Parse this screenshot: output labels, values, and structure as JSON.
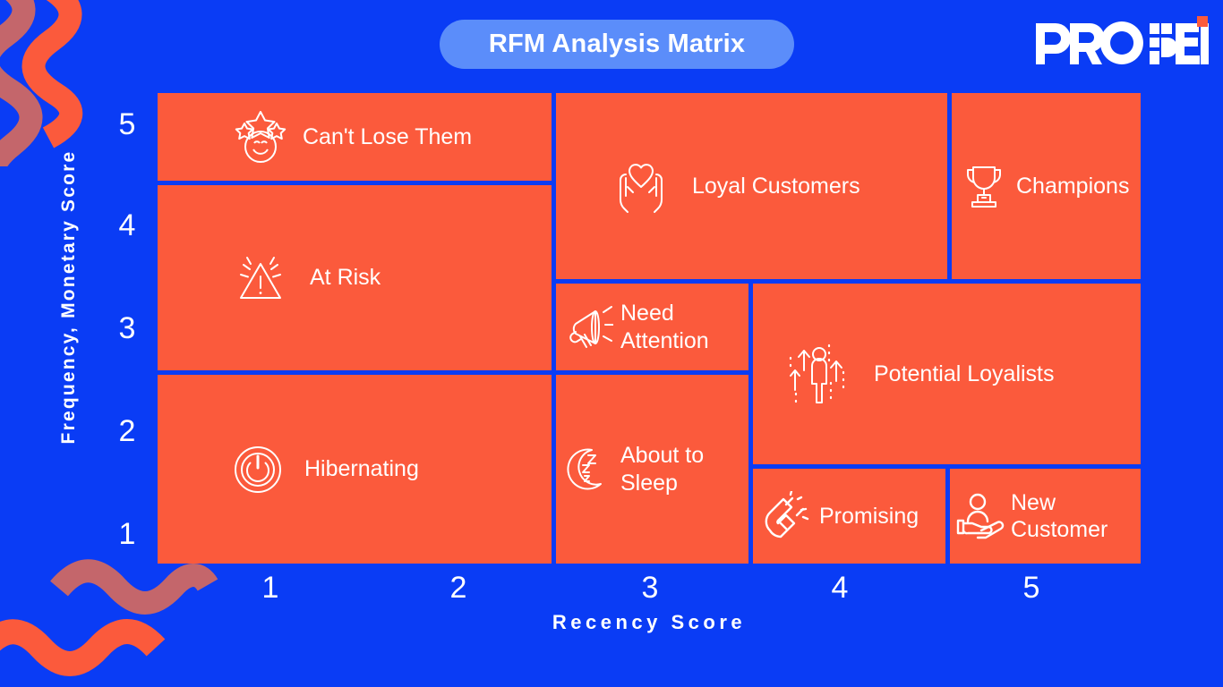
{
  "header": {
    "title": "RFM Analysis Matrix",
    "logo_text": "PROPEL",
    "logo_dot": "orange-square-dot"
  },
  "colors": {
    "background_blue": "#0a3cf5",
    "cell_orange": "#fb5a3c",
    "title_pill_blue": "#5b8dfa",
    "text_white": "#ffffff",
    "squiggle_rose": "#c4666b",
    "squiggle_orange": "#fb5a3c",
    "logo_dot_orange": "#fb5a3c"
  },
  "axes": {
    "y_title": "Frequency, Monetary Score",
    "x_title": "Recency Score",
    "y_ticks": [
      "5",
      "4",
      "3",
      "2",
      "1"
    ],
    "x_ticks": [
      "1",
      "2",
      "3",
      "4",
      "5"
    ]
  },
  "chart_data": {
    "type": "heatmap",
    "title": "RFM Analysis Matrix",
    "xlabel": "Recency Score",
    "ylabel": "Frequency, Monetary Score",
    "xlim": [
      0.5,
      5.5
    ],
    "ylim": [
      0.5,
      5.5
    ],
    "grid": false,
    "legend": "none",
    "categories_x": [
      "1",
      "2",
      "3",
      "4",
      "5"
    ],
    "categories_y": [
      "1",
      "2",
      "3",
      "4",
      "5"
    ],
    "segments": [
      {
        "label": "Can't Lose Them",
        "icon": "smiley-stars-icon",
        "recency_range": [
          1,
          2
        ],
        "frequency_range": [
          5,
          5
        ]
      },
      {
        "label": "At Risk",
        "icon": "warning-triangle-icon",
        "recency_range": [
          1,
          2
        ],
        "frequency_range": [
          3,
          4
        ]
      },
      {
        "label": "Hibernating",
        "icon": "power-button-icon",
        "recency_range": [
          1,
          2
        ],
        "frequency_range": [
          1,
          2
        ]
      },
      {
        "label": "Loyal Customers",
        "icon": "heart-in-hands-icon",
        "recency_range": [
          3,
          4
        ],
        "frequency_range": [
          4,
          5
        ]
      },
      {
        "label": "Champions",
        "icon": "trophy-icon",
        "recency_range": [
          5,
          5
        ],
        "frequency_range": [
          4,
          5
        ]
      },
      {
        "label": "Need Attention",
        "icon": "megaphone-icon",
        "recency_range": [
          3,
          3
        ],
        "frequency_range": [
          3,
          3
        ]
      },
      {
        "label": "Potential Loyalists",
        "icon": "person-growth-arrows-icon",
        "recency_range": [
          4,
          5
        ],
        "frequency_range": [
          2,
          3
        ]
      },
      {
        "label": "About to Sleep",
        "icon": "sleeping-moon-icon",
        "recency_range": [
          3,
          3
        ],
        "frequency_range": [
          1,
          2
        ]
      },
      {
        "label": "Promising",
        "icon": "magnet-icon",
        "recency_range": [
          4,
          4
        ],
        "frequency_range": [
          1,
          1
        ]
      },
      {
        "label": "New Customer",
        "icon": "person-in-hand-icon",
        "recency_range": [
          5,
          5
        ],
        "frequency_range": [
          1,
          1
        ]
      }
    ]
  },
  "cells": {
    "cant_lose_them": "Can't Lose Them",
    "at_risk": "At Risk",
    "hibernating": "Hibernating",
    "loyal_customers": "Loyal Customers",
    "champions": "Champions",
    "need_attention": "Need\nAttention",
    "potential_loyalists": "Potential Loyalists",
    "about_to_sleep": "About to\nSleep",
    "promising": "Promising",
    "new_customer": "New\nCustomer"
  }
}
